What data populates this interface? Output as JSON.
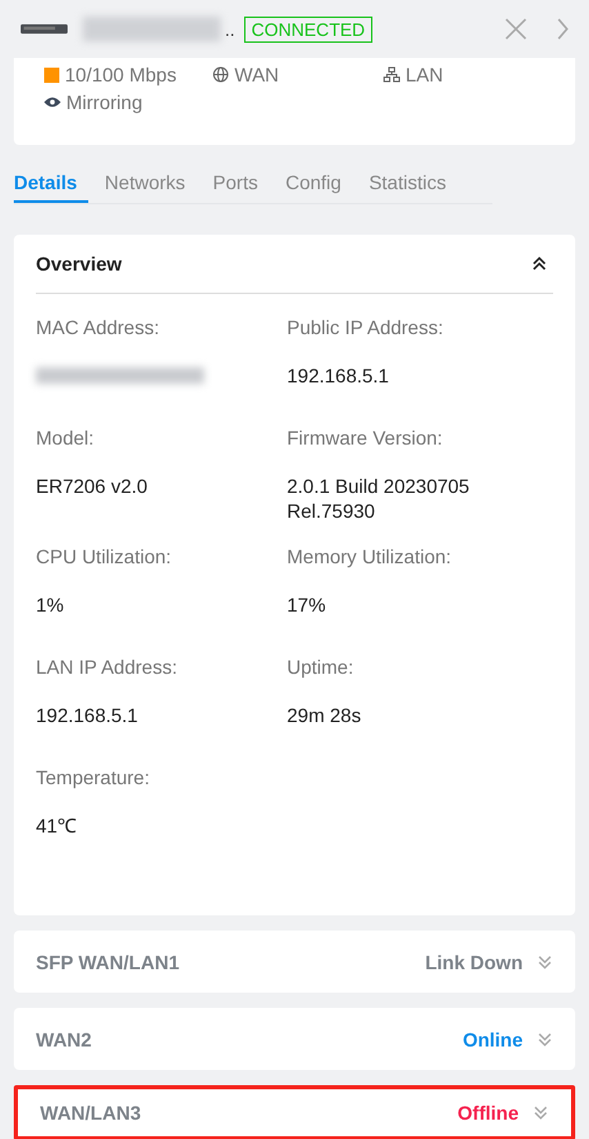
{
  "header": {
    "name_suffix": "..",
    "status": "CONNECTED"
  },
  "port_info": [
    {
      "kind": "speed",
      "label": "10/100 Mbps"
    },
    {
      "kind": "wan",
      "label": "WAN"
    },
    {
      "kind": "lan",
      "label": "LAN"
    },
    {
      "kind": "mirroring",
      "label": "Mirroring"
    }
  ],
  "tabs": [
    {
      "label": "Details",
      "selected": true
    },
    {
      "label": "Networks",
      "selected": false
    },
    {
      "label": "Ports",
      "selected": false
    },
    {
      "label": "Config",
      "selected": false
    },
    {
      "label": "Statistics",
      "selected": false
    }
  ],
  "overview": {
    "title": "Overview",
    "expanded": true,
    "fields": [
      {
        "label": "MAC Address:",
        "redacted": true
      },
      {
        "label": "Public IP Address:",
        "value": "192.168.5.1"
      },
      {
        "label": "Model:",
        "value": "ER7206 v2.0"
      },
      {
        "label": "Firmware Version:",
        "value": "2.0.1 Build 20230705 Rel.75930"
      },
      {
        "label": "CPU Utilization:",
        "value": "1%"
      },
      {
        "label": "Memory Utilization:",
        "value": "17%"
      },
      {
        "label": "LAN IP Address:",
        "value": "192.168.5.1"
      },
      {
        "label": "Uptime:",
        "value": "29m 28s"
      },
      {
        "label": "Temperature:",
        "value": "41℃"
      }
    ]
  },
  "ports": [
    {
      "name": "SFP WAN/LAN1",
      "status": "Link Down",
      "kind": "down",
      "highlighted": false
    },
    {
      "name": "WAN2",
      "status": "Online",
      "kind": "online",
      "highlighted": false
    },
    {
      "name": "WAN/LAN3",
      "status": "Offline",
      "kind": "offline",
      "highlighted": true
    }
  ]
}
